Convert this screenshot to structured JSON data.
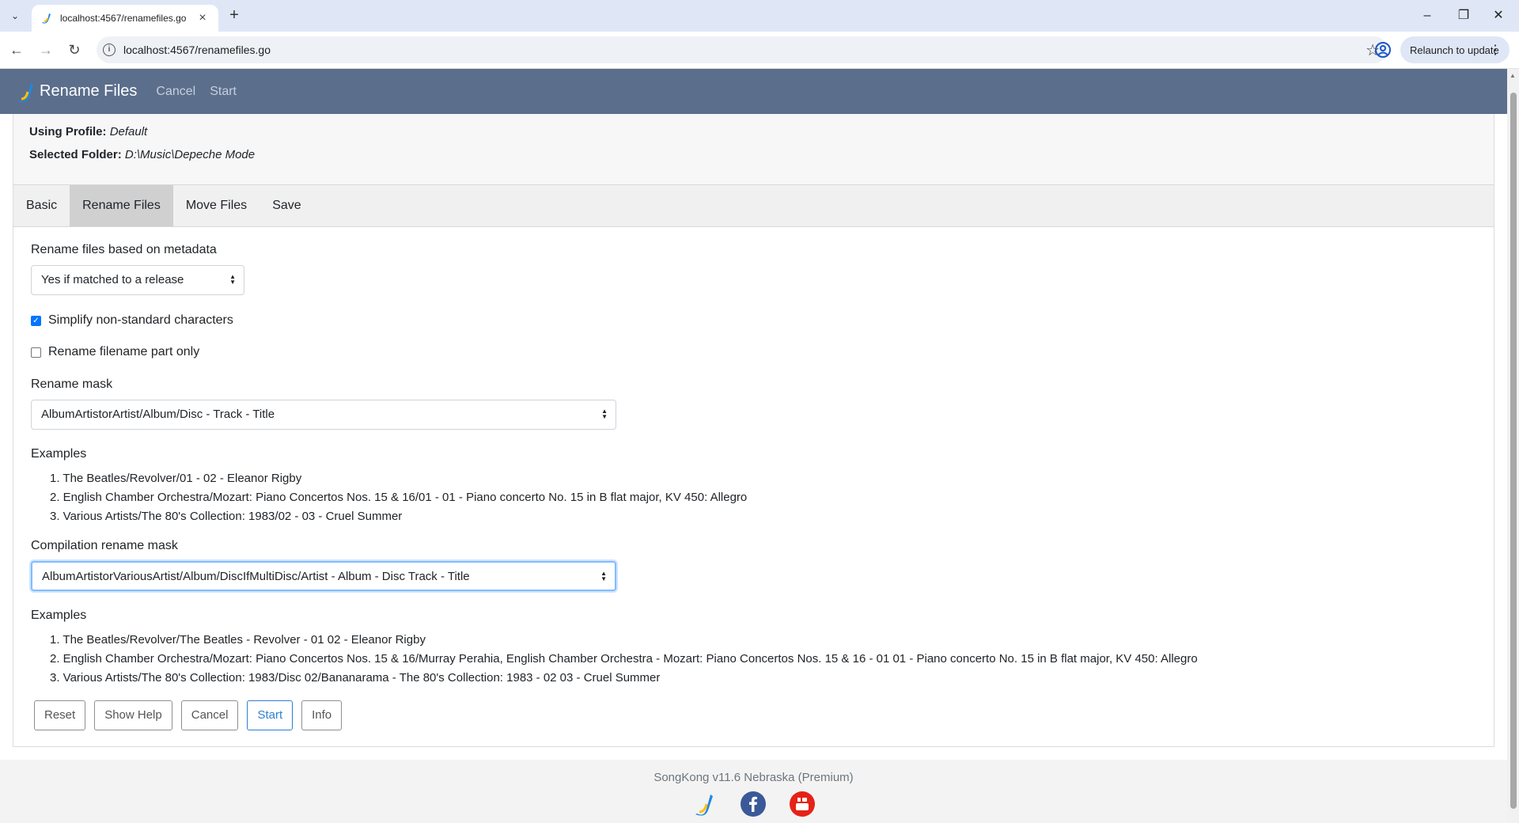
{
  "browser": {
    "tab_title": "localhost:4567/renamefiles.go",
    "url": "localhost:4567/renamefiles.go",
    "relaunch_label": "Relaunch to update"
  },
  "navbar": {
    "brand": "Rename Files",
    "links": [
      "Cancel",
      "Start"
    ]
  },
  "info": {
    "profile_label": "Using Profile:",
    "profile_value": "Default",
    "folder_label": "Selected Folder:",
    "folder_value": "D:\\Music\\Depeche Mode"
  },
  "tabs": [
    {
      "label": "Basic",
      "active": false
    },
    {
      "label": "Rename Files",
      "active": true
    },
    {
      "label": "Move Files",
      "active": false
    },
    {
      "label": "Save",
      "active": false
    }
  ],
  "form": {
    "rename_based_label": "Rename files based on metadata",
    "rename_based_value": "Yes if matched to a release",
    "simplify_label": "Simplify non-standard characters",
    "simplify_checked": true,
    "filename_only_label": "Rename filename part only",
    "filename_only_checked": false,
    "rename_mask_label": "Rename mask",
    "rename_mask_value": "AlbumArtistorArtist/Album/Disc - Track - Title",
    "examples_label": "Examples",
    "examples": [
      "1. The Beatles/Revolver/01 - 02 - Eleanor Rigby",
      "2. English Chamber Orchestra/Mozart: Piano Concertos Nos. 15 & 16/01 - 01 - Piano concerto No. 15 in B flat major, KV 450: Allegro",
      "3. Various Artists/The 80's Collection: 1983/02 - 03 - Cruel Summer"
    ],
    "compilation_mask_label": "Compilation rename mask",
    "compilation_mask_value": "AlbumArtistorVariousArtist/Album/DiscIfMultiDisc/Artist - Album - Disc Track - Title",
    "compilation_examples_label": "Examples",
    "compilation_examples": [
      "1. The Beatles/Revolver/The Beatles - Revolver - 01 02 - Eleanor Rigby",
      "2. English Chamber Orchestra/Mozart: Piano Concertos Nos. 15 & 16/Murray Perahia, English Chamber Orchestra - Mozart: Piano Concertos Nos. 15 & 16 - 01 01 - Piano concerto No. 15 in B flat major, KV 450: Allegro",
      "3. Various Artists/The 80's Collection: 1983/Disc 02/Bananarama - The 80's Collection: 1983 - 02 03 - Cruel Summer"
    ]
  },
  "buttons": {
    "reset": "Reset",
    "show_help": "Show Help",
    "cancel": "Cancel",
    "start": "Start",
    "info": "Info"
  },
  "footer": {
    "version": "SongKong v11.6 Nebraska (Premium)"
  },
  "colors": {
    "navbar": "#5b6e8c",
    "primary": "#2f7fd1",
    "facebook": "#3b5998",
    "youtube": "#e62117"
  }
}
